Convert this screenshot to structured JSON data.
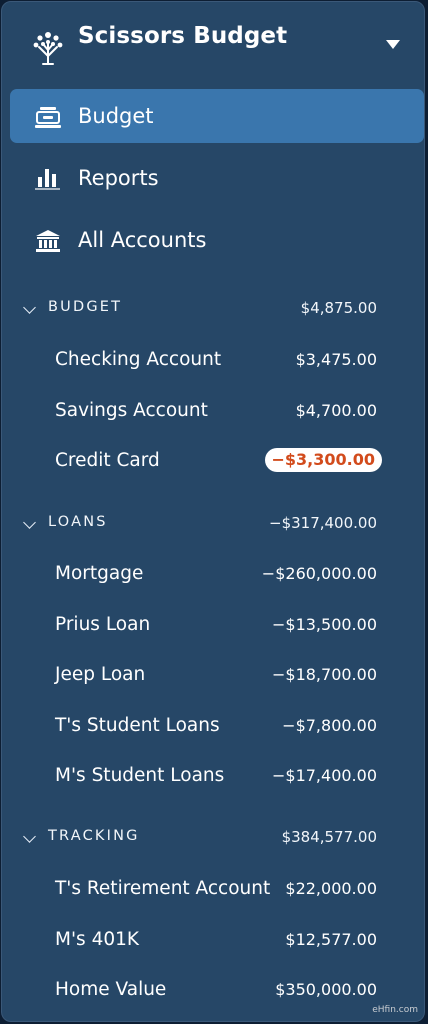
{
  "header": {
    "budget_name": "Scissors Budget",
    "icons": {
      "logo": "tree-icon",
      "menu": "caret-down-icon"
    }
  },
  "nav": [
    {
      "label": "Budget",
      "icon": "budget-wallet-icon",
      "active": true
    },
    {
      "label": "Reports",
      "icon": "bar-chart-icon",
      "active": false
    },
    {
      "label": "All Accounts",
      "icon": "bank-icon",
      "active": false
    }
  ],
  "groups": [
    {
      "label": "BUDGET",
      "balance": "$4,875.00",
      "accounts": [
        {
          "name": "Checking Account",
          "balance": "$3,475.00"
        },
        {
          "name": "Savings Account",
          "balance": "$4,700.00"
        },
        {
          "name": "Credit Card",
          "balance": "−$3,300.00",
          "highlight": true
        }
      ]
    },
    {
      "label": "LOANS",
      "balance": "−$317,400.00",
      "accounts": [
        {
          "name": "Mortgage",
          "balance": "−$260,000.00"
        },
        {
          "name": "Prius Loan",
          "balance": "−$13,500.00"
        },
        {
          "name": "Jeep Loan",
          "balance": "−$18,700.00"
        },
        {
          "name": "T's Student Loans",
          "balance": "−$7,800.00"
        },
        {
          "name": "M's Student Loans",
          "balance": "−$17,400.00"
        }
      ]
    },
    {
      "label": "TRACKING",
      "balance": "$384,577.00",
      "accounts": [
        {
          "name": "T's Retirement Account",
          "balance": "$22,000.00"
        },
        {
          "name": "M's 401K",
          "balance": "$12,577.00"
        },
        {
          "name": "Home Value",
          "balance": "$350,000.00"
        }
      ]
    }
  ],
  "watermark": "eHfin.com",
  "colors": {
    "sidebar_bg": "#264767",
    "active_bg": "#3a76ad",
    "negative_text": "#d24b1c"
  }
}
